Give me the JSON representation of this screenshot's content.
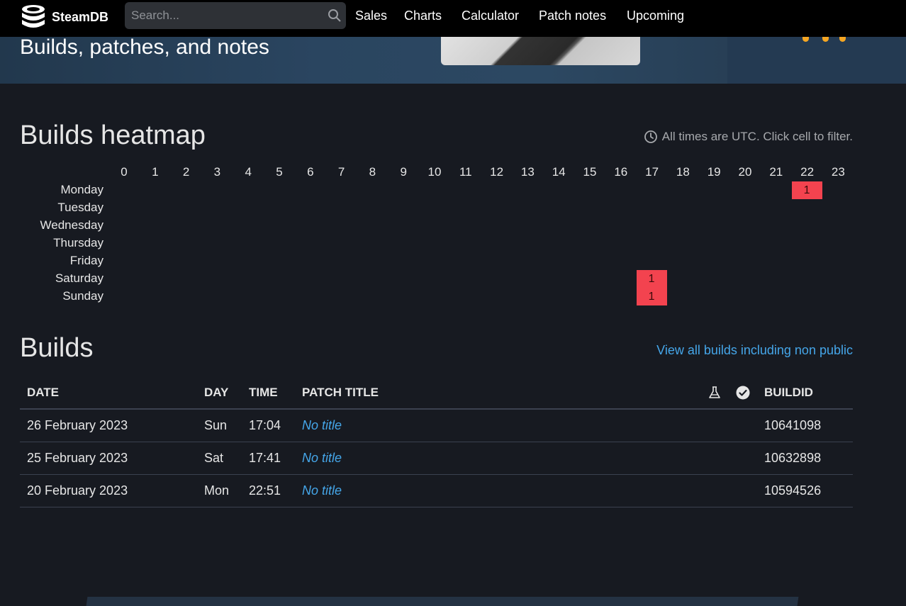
{
  "nav": {
    "brand": "SteamDB",
    "search_placeholder": "Search...",
    "links": [
      "Sales",
      "Charts",
      "Calculator",
      "Patch notes",
      "Upcoming"
    ]
  },
  "hero": {
    "subtitle": "Builds, patches, and notes"
  },
  "heatmap": {
    "title": "Builds heatmap",
    "note": "All times are UTC. Click cell to filter.",
    "hours": [
      "0",
      "1",
      "2",
      "3",
      "4",
      "5",
      "6",
      "7",
      "8",
      "9",
      "10",
      "11",
      "12",
      "13",
      "14",
      "15",
      "16",
      "17",
      "18",
      "19",
      "20",
      "21",
      "22",
      "23"
    ],
    "days": [
      "Monday",
      "Tuesday",
      "Wednesday",
      "Thursday",
      "Friday",
      "Saturday",
      "Sunday"
    ],
    "cells": [
      {
        "day": "Monday",
        "hour": 22,
        "count": "1"
      },
      {
        "day": "Saturday",
        "hour": 17,
        "count": "1"
      },
      {
        "day": "Sunday",
        "hour": 17,
        "count": "1"
      }
    ],
    "hot_color": "#f3434f"
  },
  "builds": {
    "title": "Builds",
    "view_all": "View all builds including non public",
    "columns": {
      "date": "DATE",
      "day": "DAY",
      "time": "TIME",
      "patch_title": "PATCH TITLE",
      "buildid": "BUILDID"
    },
    "rows": [
      {
        "date": "26 February 2023",
        "day": "Sun",
        "time": "17:04",
        "patch_title": "No title",
        "buildid": "10641098"
      },
      {
        "date": "25 February 2023",
        "day": "Sat",
        "time": "17:41",
        "patch_title": "No title",
        "buildid": "10632898"
      },
      {
        "date": "20 February 2023",
        "day": "Mon",
        "time": "22:51",
        "patch_title": "No title",
        "buildid": "10594526"
      }
    ]
  },
  "colors": {
    "background": "#171a21",
    "link": "#45a6e9",
    "accent": "#f5a623"
  }
}
